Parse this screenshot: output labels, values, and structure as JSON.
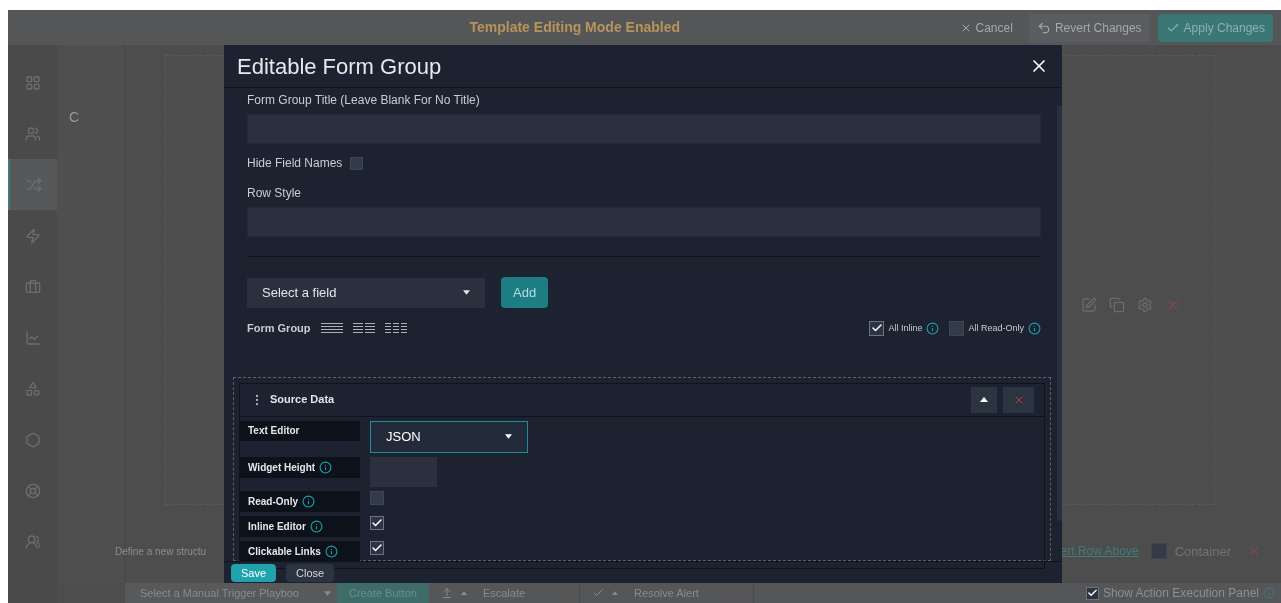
{
  "top_bar": {
    "title": "Template Editing Mode Enabled",
    "buttons": [
      {
        "label": "Cancel",
        "kind": "cancel"
      },
      {
        "label": "Revert Changes",
        "kind": "revert"
      },
      {
        "label": "Apply Changes",
        "kind": "apply"
      }
    ]
  },
  "sidebar": {
    "items": [
      {
        "selected": false
      },
      {
        "selected": false
      },
      {
        "selected": true
      },
      {
        "selected": false
      },
      {
        "selected": false
      },
      {
        "selected": false
      },
      {
        "selected": false
      },
      {
        "selected": false
      },
      {
        "selected": false
      },
      {
        "selected": false
      }
    ]
  },
  "background": {
    "tab_fragment": "C",
    "hint": "Define a new structu",
    "link": "ert Row Above",
    "container_option": {
      "label": "Container",
      "checked": false
    }
  },
  "modal": {
    "title": "Editable Form Group",
    "title_field": {
      "label": "Form Group Title (Leave Blank For No Title)"
    },
    "hide_field_names": {
      "label": "Hide Field Names",
      "checked": false
    },
    "row_style": {
      "label": "Row Style"
    },
    "field_select": {
      "value": "Select a field"
    },
    "add_button": "Add",
    "form_group_label": "Form Group",
    "toggles": [
      {
        "label": "All Inline",
        "checked": true
      },
      {
        "label": "All Read-Only",
        "checked": false
      }
    ],
    "source_data": {
      "title": "Source Data",
      "rows": [
        {
          "label": "Text Editor",
          "kind": "select",
          "value": "JSON",
          "info": false
        },
        {
          "label": "Widget Height",
          "kind": "input",
          "info": true
        },
        {
          "label": "Read-Only",
          "kind": "checkbox",
          "checked": false,
          "info": true
        },
        {
          "label": "Inline Editor",
          "kind": "checkbox",
          "checked": true,
          "info": true
        },
        {
          "label": "Clickable Links",
          "kind": "checkbox",
          "checked": true,
          "info": true
        }
      ]
    },
    "footer_buttons": [
      {
        "label": "Save",
        "kind": "primary"
      },
      {
        "label": "Close",
        "kind": "secondary"
      }
    ]
  },
  "bottom_bar": {
    "playbook_select": "Select a Manual Trigger Playboo",
    "create_button": "Create Button",
    "actions": [
      {
        "label": "Escalate",
        "kind": "escalate"
      },
      {
        "label": "Resolve Alert",
        "kind": "resolve"
      }
    ],
    "execution_panel": {
      "label": "Show Action Execution Panel",
      "checked": true
    }
  }
}
